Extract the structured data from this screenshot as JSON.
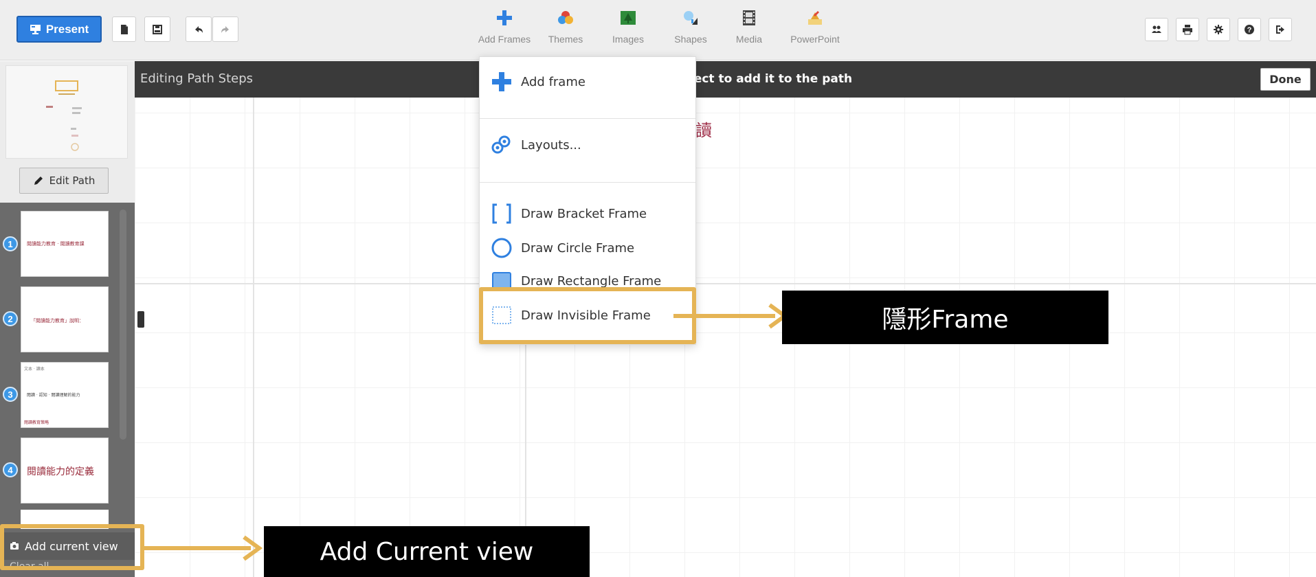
{
  "toolbar": {
    "present_label": "Present",
    "insert_menu": [
      {
        "name": "add-frames",
        "label": "Add Frames",
        "color": "#2f80e0"
      },
      {
        "name": "themes",
        "label": "Themes",
        "color": "#e0453a"
      },
      {
        "name": "images",
        "label": "Images",
        "color": "#2e8b3a"
      },
      {
        "name": "shapes",
        "label": "Shapes",
        "color": "#3d98e6"
      },
      {
        "name": "media",
        "label": "Media",
        "color": "#444444"
      },
      {
        "name": "powerpoint",
        "label": "PowerPoint",
        "color": "#e5b455"
      }
    ]
  },
  "sidebar": {
    "edit_path_label": "Edit Path",
    "slides": [
      {
        "number": "1",
        "text": "閱讀能力教育 · 閱讀教育課"
      },
      {
        "number": "2",
        "text": "「閱讀能力教育」說明："
      },
      {
        "number": "3",
        "text_top": "文本 · 讀本",
        "text": "閱讀 · 認知 · 閱讀理解的能力",
        "text_bottom": "閱讀教育策略"
      },
      {
        "number": "4",
        "text": "閱讀能力的定義"
      }
    ],
    "add_current_view_label": "Add current view",
    "clear_all_label": "Clear all"
  },
  "path_bar": {
    "title": "Editing Path Steps",
    "instruction": "ject to add it to the path",
    "done_label": "Done"
  },
  "dropdown": {
    "add_frame": "Add frame",
    "layouts": "Layouts...",
    "draw_bracket": "Draw Bracket Frame",
    "draw_circle": "Draw Circle Frame",
    "draw_rectangle": "Draw Rectangle Frame",
    "draw_invisible": "Draw Invisible Frame"
  },
  "canvas": {
    "partial_char": "讀"
  },
  "annotations": {
    "invisible_frame_label": "隱形Frame",
    "add_current_view_label": "Add Current view",
    "highlight_color": "#e5b455"
  }
}
